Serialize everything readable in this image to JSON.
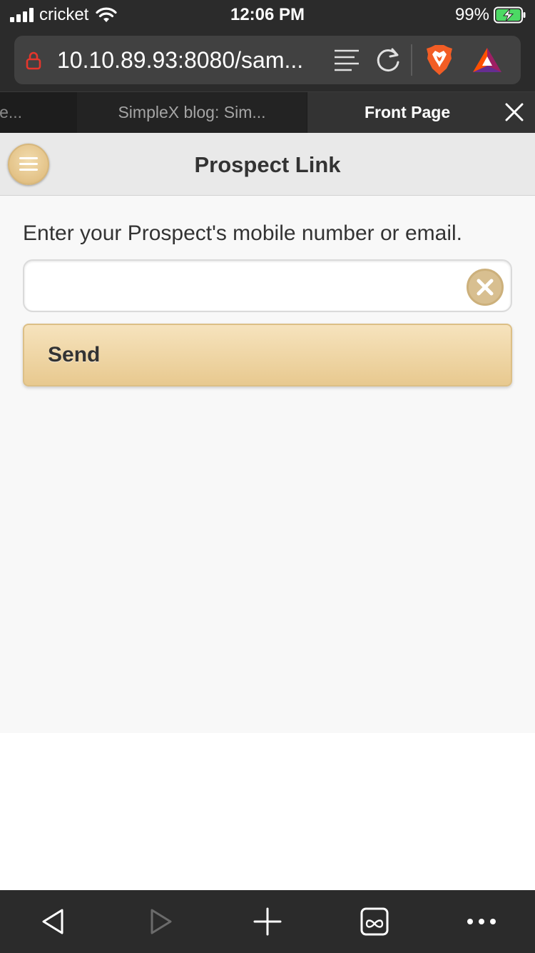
{
  "status_bar": {
    "carrier": "cricket",
    "time": "12:06 PM",
    "battery_percent": "99%"
  },
  "browser": {
    "url": "10.10.89.93:8080/sam...",
    "tabs": [
      {
        "label": "le...",
        "active": false
      },
      {
        "label": "SimpleX blog: Sim...",
        "active": false
      },
      {
        "label": "Front Page",
        "active": true
      }
    ],
    "icons": {
      "lock": "lock-icon",
      "reader": "reader-mode-icon",
      "reload": "reload-icon",
      "shields": "brave-shields-icon",
      "rewards": "brave-rewards-icon",
      "close_tab": "close-icon"
    }
  },
  "page": {
    "title": "Prospect Link",
    "prompt": "Enter your Prospect's mobile number or email.",
    "input": {
      "value": "",
      "placeholder": ""
    },
    "send_label": "Send"
  },
  "toolbar": {
    "items": [
      "back-icon",
      "forward-icon",
      "plus-icon",
      "tabs-icon",
      "more-icon"
    ]
  },
  "colors": {
    "chrome": "#2b2b2b",
    "page_bg": "#f8f8f8",
    "accent_gold": "#e8c98f",
    "text": "#333333"
  }
}
